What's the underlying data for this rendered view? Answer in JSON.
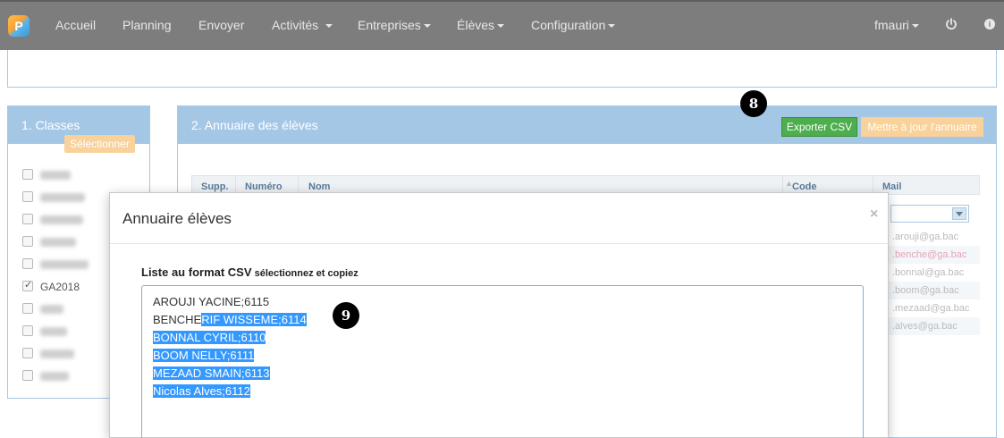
{
  "navbar": {
    "logo": "P",
    "items": [
      {
        "label": "Accueil",
        "dropdown": false
      },
      {
        "label": "Planning",
        "dropdown": false
      },
      {
        "label": "Envoyer",
        "dropdown": false
      },
      {
        "label": "Activités",
        "dropdown": true
      },
      {
        "label": "Entreprises",
        "dropdown": true
      },
      {
        "label": "Élèves",
        "dropdown": true
      },
      {
        "label": "Configuration",
        "dropdown": true
      }
    ],
    "user": "fmauri",
    "power_icon": "power-icon",
    "info_icon": "info-icon"
  },
  "classes": {
    "title": "1. Classes",
    "select_button": "Sélectionner",
    "items": [
      {
        "label": "",
        "checked": false,
        "blurred": true
      },
      {
        "label": "",
        "checked": false,
        "blurred": true
      },
      {
        "label": "",
        "checked": false,
        "blurred": true
      },
      {
        "label": "",
        "checked": false,
        "blurred": true
      },
      {
        "label": "",
        "checked": false,
        "blurred": true
      },
      {
        "label": "GA2018",
        "checked": true,
        "blurred": false
      },
      {
        "label": "",
        "checked": false,
        "blurred": true
      },
      {
        "label": "",
        "checked": false,
        "blurred": true
      },
      {
        "label": "",
        "checked": false,
        "blurred": true
      },
      {
        "label": "",
        "checked": false,
        "blurred": true
      }
    ]
  },
  "directory": {
    "title": "2. Annuaire des élèves",
    "export_button": "Exporter CSV",
    "update_button": "Mettre à jour l'annuaire",
    "columns": [
      "Supp.",
      "Numéro",
      "Nom",
      "Code",
      "Mail"
    ],
    "mails": [
      ".arouji@ga.bac",
      ".benche@ga.bac",
      ".bonnal@ga.bac",
      ".boom@ga.bac",
      ".mezaad@ga.bac",
      ".alves@ga.bac"
    ]
  },
  "modal": {
    "title": "Annuaire élèves",
    "close": "×",
    "label_bold": "Liste au format CSV",
    "label_small": " sélectionnez et copiez",
    "lines": [
      {
        "plain": "AROUJI YACINE;6115",
        "selected": ""
      },
      {
        "plain": "BENCHE",
        "selected": "RIF WISSEME;6114"
      },
      {
        "plain": "",
        "selected": "BONNAL CYRIL;6110"
      },
      {
        "plain": "",
        "selected": "BOOM NELLY;6111"
      },
      {
        "plain": "",
        "selected": "MEZAAD SMAIN;6113"
      },
      {
        "plain": "",
        "selected": "Nicolas Alves;6112"
      }
    ]
  },
  "badges": {
    "step8": "8",
    "step9": "9"
  },
  "colors": {
    "navbar": "#7d7d7d",
    "panel_header": "#a5c7e6",
    "export_button": "#4cae4c",
    "update_button": "#f9d19a",
    "selection": "#3399ff"
  }
}
